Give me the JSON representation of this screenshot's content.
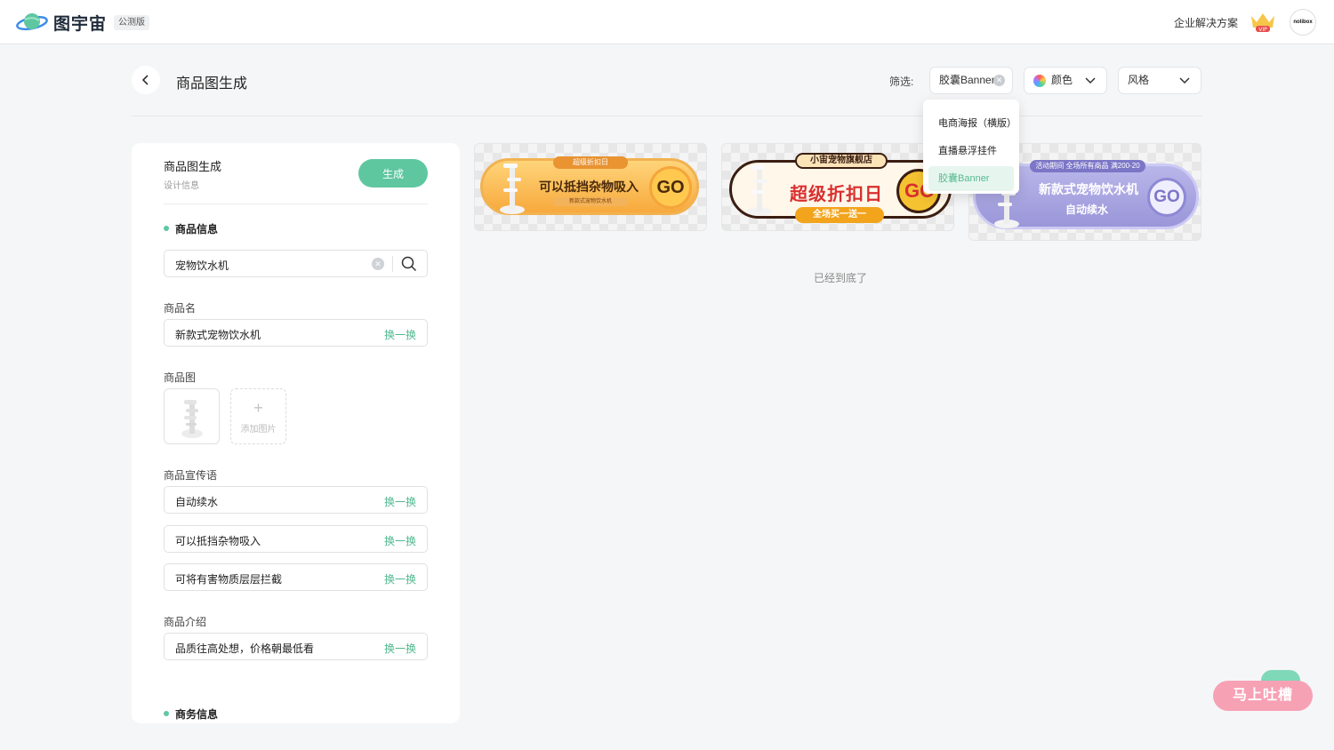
{
  "nav": {
    "brand": "图宇宙",
    "beta": "公测版",
    "enterprise": "企业解决方案",
    "vip": "VIP",
    "avatar": "nolibox"
  },
  "header": {
    "title": "商品图生成",
    "filter_label": "筛选:",
    "filters": {
      "type": "胶囊Banner",
      "color": "颜色",
      "style": "风格"
    }
  },
  "dropdown": {
    "items": [
      "电商海报（横版）",
      "直播悬浮挂件",
      "胶囊Banner"
    ],
    "selected": "胶囊Banner"
  },
  "form": {
    "title": "商品图生成",
    "subtitle": "设计信息",
    "generate_label": "生成",
    "section_product": "商品信息",
    "search_value": "宠物饮水机",
    "name_label": "商品名",
    "name_value": "新款式宠物饮水机",
    "swap_label": "换一换",
    "image_label": "商品图",
    "add_image_label": "添加图片",
    "slogan_label": "商品宣传语",
    "slogans": [
      "自动续水",
      "可以抵挡杂物吸入",
      "可将有害物质层层拦截"
    ],
    "intro_label": "商品介绍",
    "intro_value": "品质往高处想，价格朝最低看",
    "section_business": "商务信息"
  },
  "results": [
    {
      "badge": "超级折扣日",
      "headline": "可以抵挡杂物吸入",
      "subline": "新款式宠物饮水机",
      "go": "GO"
    },
    {
      "store": "小宙宠物旗舰店",
      "headline": "超级折扣日",
      "pill": "全场买一送一",
      "go": "GO"
    },
    {
      "badge": "活动期间 全场所有商品 满200-20",
      "headline": "新款式宠物饮水机",
      "subline": "自动续水",
      "go": "GO"
    }
  ],
  "end_text": "已经到底了",
  "feedback": "马上吐槽",
  "colors": {
    "accent": "#5fc7a0",
    "swap_text": "#4fb88f",
    "feedback_pink": "#f7a1b4"
  }
}
